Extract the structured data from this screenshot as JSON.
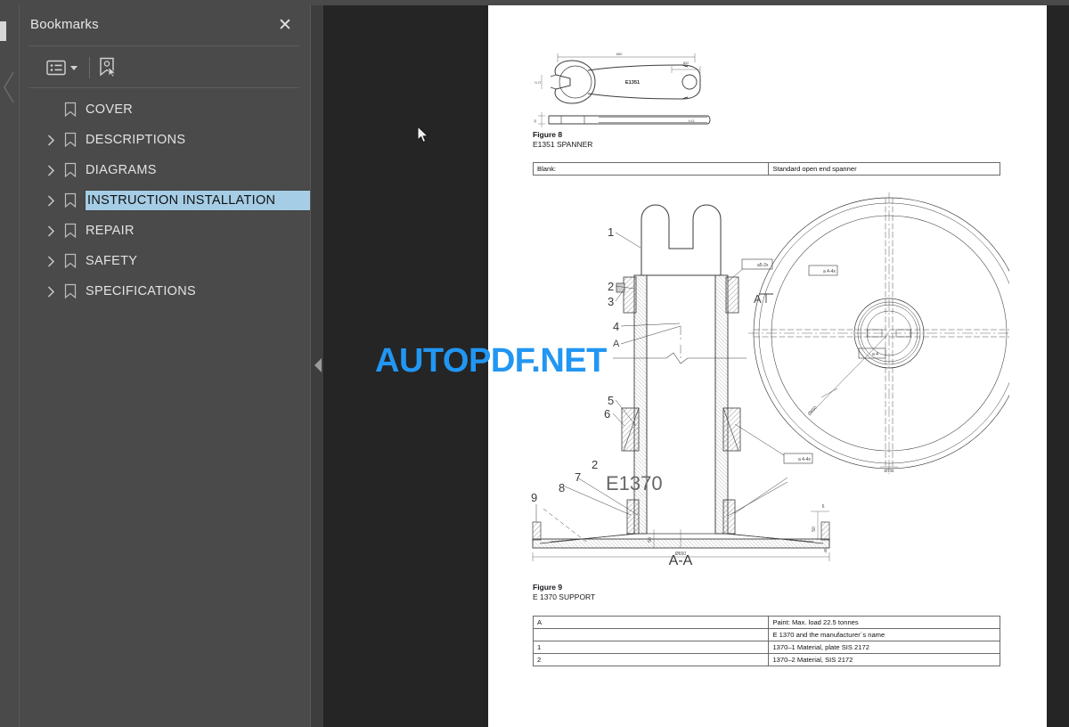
{
  "app": {
    "background_color": "#252525",
    "sidebar_color": "#4a4a4a",
    "accent_color": "#2196f3",
    "selection_color": "#a6cde6"
  },
  "sidebar": {
    "title": "Bookmarks",
    "close_label": "✕",
    "toolbar": [
      {
        "name": "bookmark-options",
        "icon": "list-options-icon",
        "has_caret": true
      },
      {
        "name": "new-bookmark",
        "icon": "new-bookmark-icon",
        "has_caret": false
      }
    ],
    "items": [
      {
        "label": "COVER",
        "expandable": false,
        "selected": false
      },
      {
        "label": "DESCRIPTIONS",
        "expandable": true,
        "selected": false
      },
      {
        "label": "DIAGRAMS",
        "expandable": true,
        "selected": false
      },
      {
        "label": "INSTRUCTION INSTALLATION",
        "expandable": true,
        "selected": true
      },
      {
        "label": "REPAIR",
        "expandable": true,
        "selected": false
      },
      {
        "label": "SAFETY",
        "expandable": true,
        "selected": false
      },
      {
        "label": "SPECIFICATIONS",
        "expandable": true,
        "selected": false
      }
    ]
  },
  "viewer": {
    "collapse_panel_icon": "collapse-left-triangle-icon",
    "watermark": "AUTOPDF.NET"
  },
  "page": {
    "figure8": {
      "caption_title": "Figure 8",
      "caption_subtitle": "E1351 SPANNER",
      "part_label": "E1351",
      "table": {
        "rows": [
          {
            "left": "Blank:",
            "right": "Standard open end spanner"
          }
        ]
      }
    },
    "figure9": {
      "caption_title": "Figure 9",
      "caption_subtitle": "E 1370 SUPPORT",
      "part_label": "E1370",
      "section_label": "A-A",
      "view_marker": "A",
      "diameter_label": "Ø650",
      "callouts": [
        "1",
        "2",
        "3",
        "4",
        "5",
        "6",
        "7",
        "8",
        "9",
        "2"
      ],
      "table": {
        "rows": [
          {
            "left": "A",
            "right": "Paint: Max. load 22.5 tonnes"
          },
          {
            "left": "",
            "right": "E 1370 and the manufacturer´s name"
          },
          {
            "left": "1",
            "right": "1370–1 Material, plate SIS 2172"
          },
          {
            "left": "2",
            "right": "1370–2 Material, SIS 2172"
          }
        ]
      }
    }
  }
}
